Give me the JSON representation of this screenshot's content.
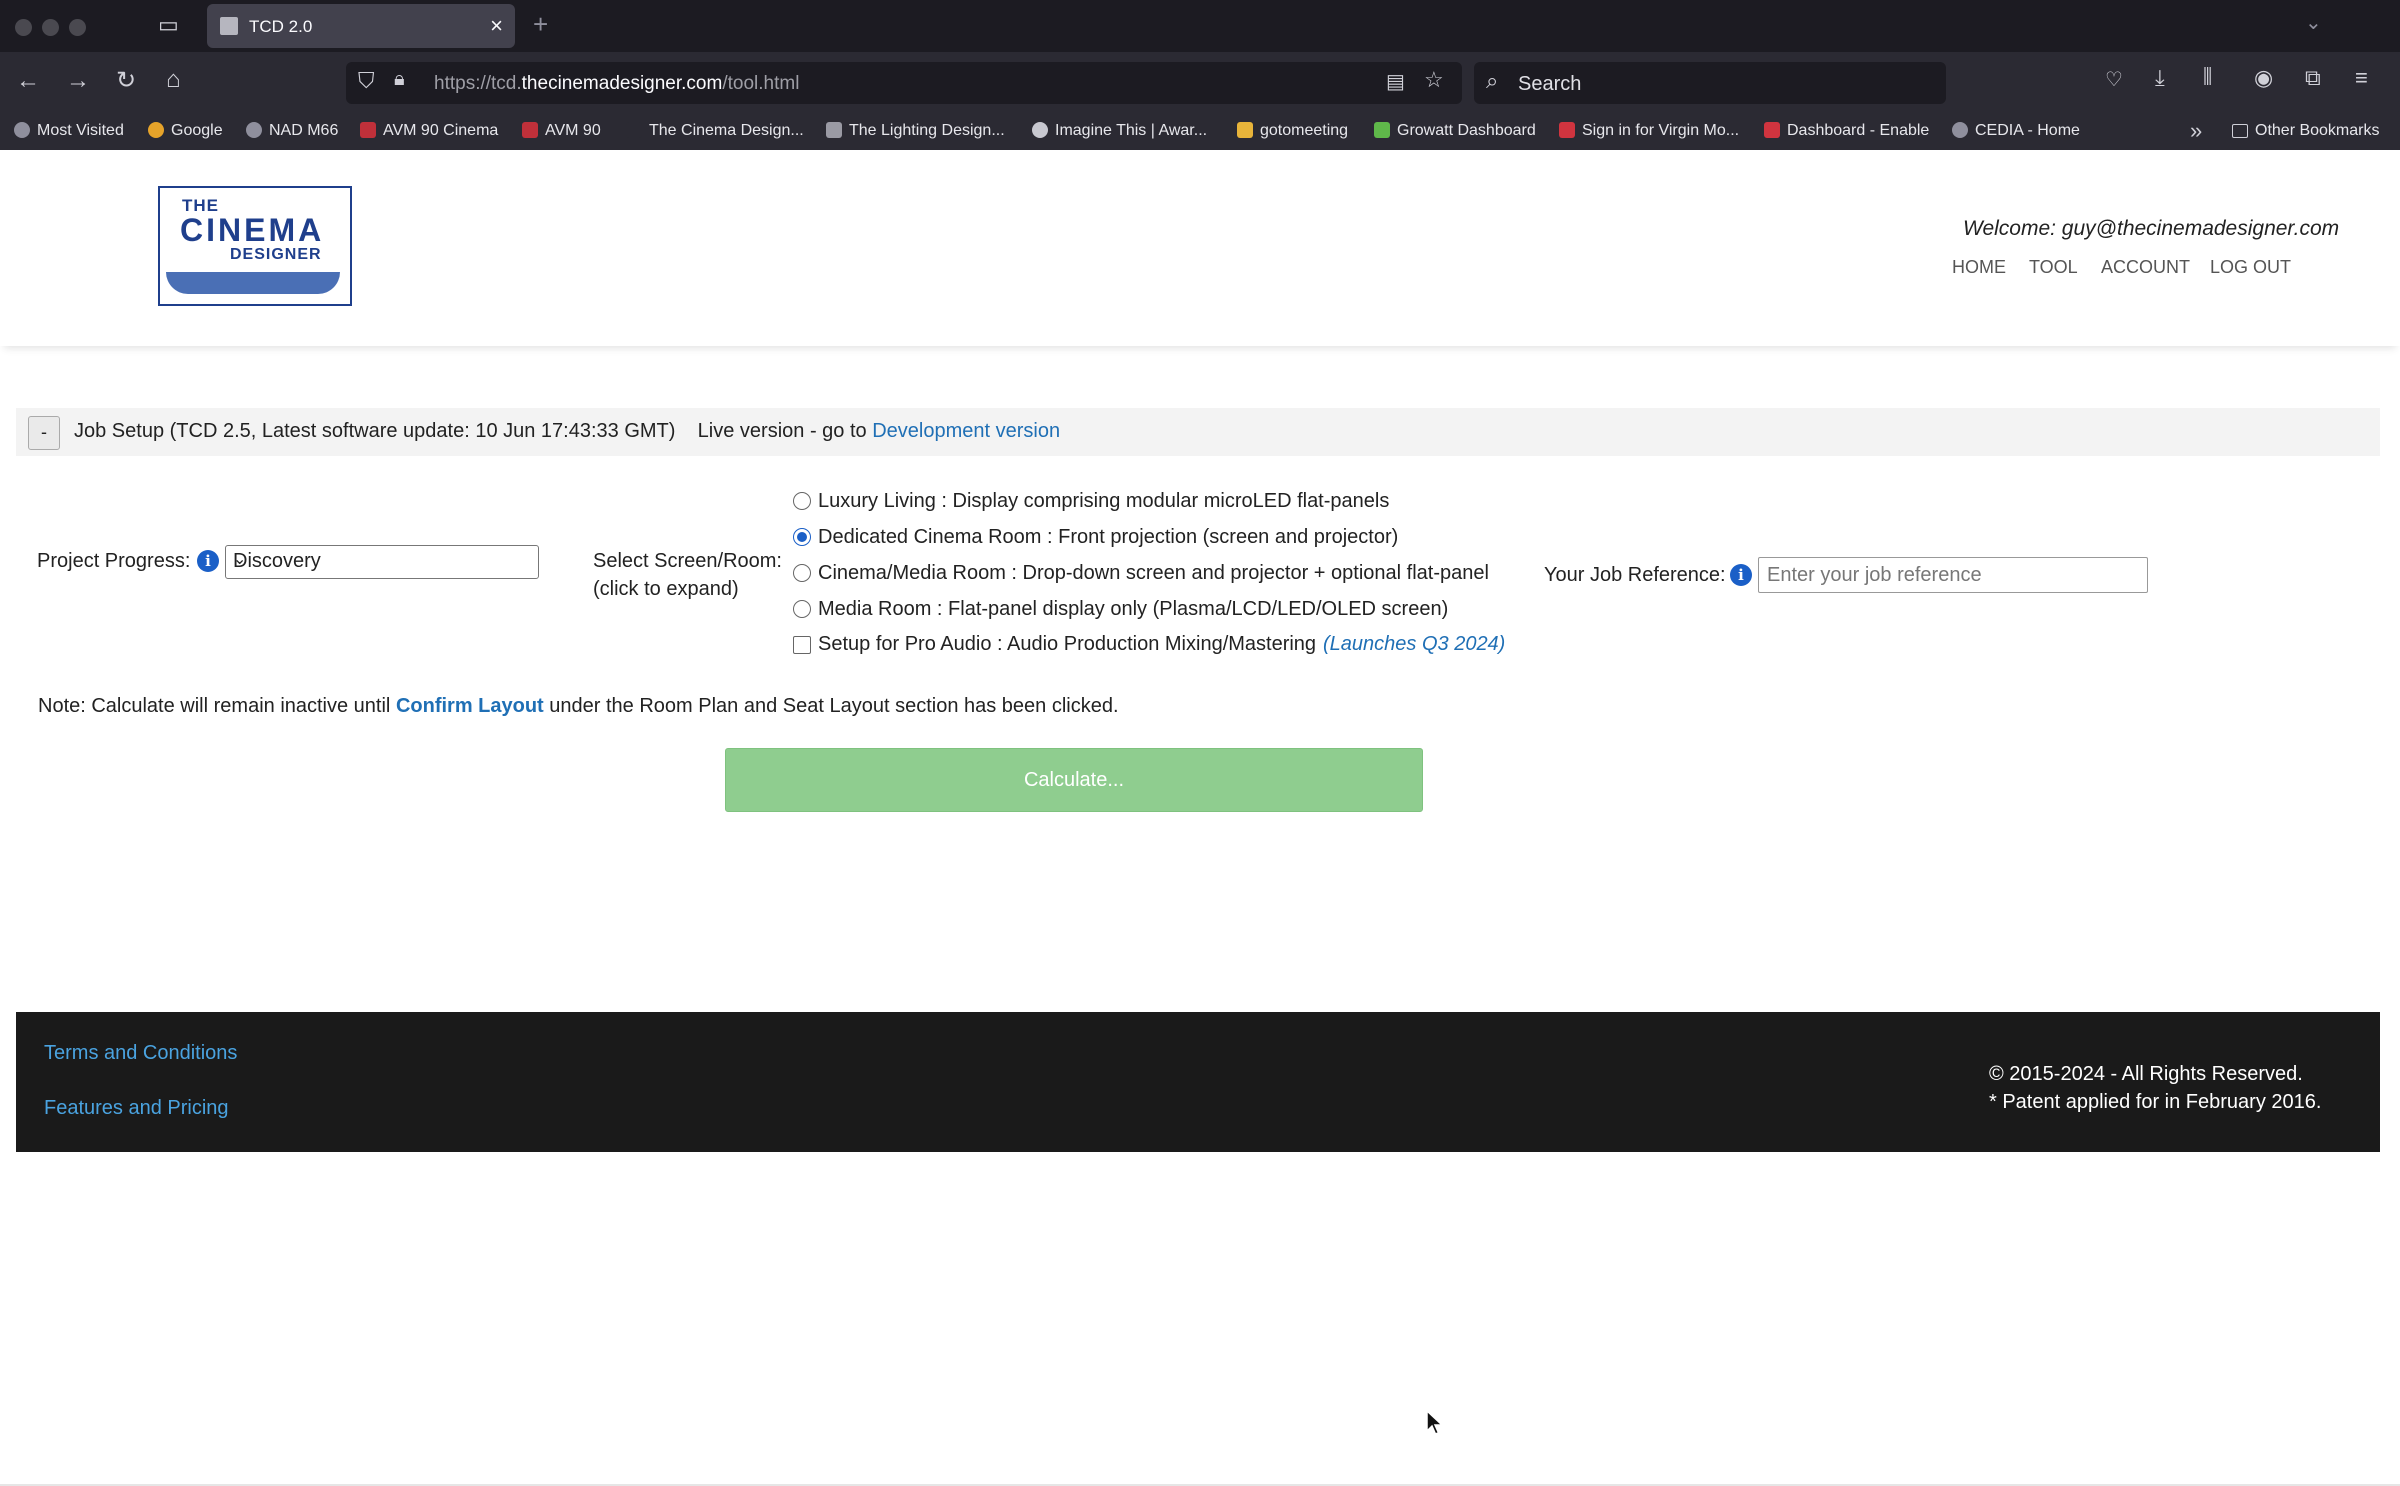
{
  "browser": {
    "tab_title": "TCD 2.0",
    "url_host_prefix": "https://tcd.",
    "url_host_main": "thecinemadesigner.com",
    "url_path": "/tool.html",
    "search_placeholder": "Search",
    "bookmarks": [
      "Most Visited",
      "Google",
      "NAD M66",
      "AVM 90 Cinema",
      "AVM 90",
      "The Cinema Design...",
      "The Lighting Design...",
      "Imagine This | Awar...",
      "gotomeeting",
      "Growatt Dashboard",
      "Sign in for Virgin Mo...",
      "Dashboard - Enable",
      "CEDIA - Home"
    ],
    "other_bookmarks": "Other Bookmarks"
  },
  "header": {
    "logo_line1": "THE",
    "logo_line2": "CINEMA",
    "logo_line3": "DESIGNER",
    "welcome": "Welcome: guy@thecinemadesigner.com",
    "nav": [
      "HOME",
      "TOOL",
      "ACCOUNT",
      "LOG OUT"
    ]
  },
  "job_setup": {
    "collapse_label": "-",
    "title": "Job Setup (TCD 2.5, Latest software update: 10 Jun 17:43:33 GMT)",
    "live_text": "Live version - go to",
    "dev_link": "Development version"
  },
  "form": {
    "progress_label": "Project Progress:",
    "progress_value": "Discovery",
    "screen_label": "Select Screen/Room:",
    "screen_sublabel": "(click to expand)",
    "room_options": [
      {
        "label": "Luxury Living : Display comprising modular microLED flat-panels",
        "selected": false
      },
      {
        "label": "Dedicated Cinema Room : Front projection (screen and projector)",
        "selected": true
      },
      {
        "label": "Cinema/Media Room : Drop-down screen and projector + optional flat-panel",
        "selected": false
      },
      {
        "label": "Media Room : Flat-panel display only (Plasma/LCD/LED/OLED screen)",
        "selected": false
      }
    ],
    "pro_audio_label": "Setup for Pro Audio : Audio Production Mixing/Mastering",
    "pro_audio_checked": false,
    "launch_note": "(Launches Q3 2024)",
    "job_ref_label": "Your Job Reference:",
    "job_ref_placeholder": "Enter your job reference",
    "info_icon_glyph": "i"
  },
  "note": {
    "before": "Note: Calculate will remain inactive until",
    "link": "Confirm Layout",
    "after": "under the Room Plan and Seat Layout section has been clicked."
  },
  "calculate_label": "Calculate...",
  "footer": {
    "links": [
      "Terms and Conditions",
      "Features and Pricing"
    ],
    "copyright": "© 2015-2024 - All Rights Reserved.",
    "patent": "* Patent applied for in February 2016."
  },
  "colors": {
    "accent_blue": "#1a5fc7",
    "link_blue": "#1f6fb5",
    "calc_green": "#8fcd8f",
    "footer_bg": "#1a1a1a"
  }
}
